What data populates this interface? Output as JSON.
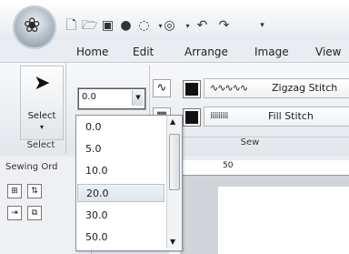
{
  "app": {
    "logo_icon": "flower-logo-icon"
  },
  "quick_access": [
    "new-file-icon",
    "open-folder-icon",
    "save-icon",
    "record-icon",
    "dotted-circle-icon",
    "circle-icon",
    "undo-icon",
    "redo-icon",
    "customize-icon"
  ],
  "tabs": [
    {
      "label": "Home"
    },
    {
      "label": "Edit"
    },
    {
      "label": "Arrange"
    },
    {
      "label": "Image"
    },
    {
      "label": "View"
    }
  ],
  "select_group": {
    "button_label": "Select",
    "group_label": "Select"
  },
  "combo": {
    "value": "0.0"
  },
  "sew": {
    "zigzag_label": "Zigzag Stitch",
    "fill_label": "Fill Stitch",
    "group_label": "Sew"
  },
  "sewing_order": {
    "header": "Sewing Ord"
  },
  "ruler": {
    "mark": "50"
  },
  "dropdown": {
    "options": [
      "0.0",
      "5.0",
      "10.0",
      "20.0",
      "30.0",
      "50.0"
    ],
    "selected_index": 3
  },
  "colors": {
    "ribbon_bg": "#e9ecf0",
    "selected_option": "#dfe5ec",
    "stitch_color": "#111111"
  }
}
